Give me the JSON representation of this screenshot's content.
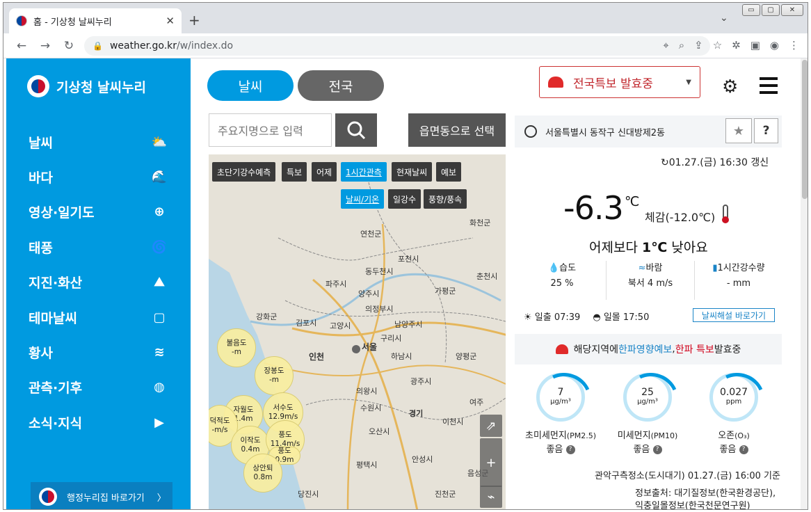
{
  "browser": {
    "tab_title": "홈 - 기상청 날씨누리",
    "tab_close": "✕",
    "new_tab": "+",
    "url_host": "weather.go.kr",
    "url_path": "/w/index.do",
    "win_min": "▭",
    "win_max": "▢",
    "win_close": "✕"
  },
  "sidebar": {
    "logo": "기상청 날씨누리",
    "items": [
      {
        "label": "날씨",
        "icon": "⛅"
      },
      {
        "label": "바다",
        "icon": "🌊"
      },
      {
        "label": "영상·일기도",
        "icon": "⊕"
      },
      {
        "label": "태풍",
        "icon": "🌀"
      },
      {
        "label": "지진·화산",
        "icon": "⛰"
      },
      {
        "label": "테마날씨",
        "icon": "▢"
      },
      {
        "label": "황사",
        "icon": "≋"
      },
      {
        "label": "관측·기후",
        "icon": "◍"
      },
      {
        "label": "소식·지식",
        "icon": "▶"
      }
    ],
    "shortcut": "행정누리집 바로가기",
    "shortcut_arrow": "〉"
  },
  "header": {
    "tab_weather": "날씨",
    "tab_nation": "전국",
    "alert": "전국특보 발효중",
    "alert_caret": "▼"
  },
  "search": {
    "placeholder": "주요지명으로 입력",
    "dong_button": "읍면동으로 선택"
  },
  "map": {
    "tabs": [
      "초단기강수예측",
      "특보",
      "어제",
      "1시간관측",
      "현재날씨",
      "예보"
    ],
    "subtabs": [
      "날씨/기온",
      "일강수",
      "풍향/풍속"
    ],
    "cities": [
      {
        "name": "화천군"
      },
      {
        "name": "연천군"
      },
      {
        "name": "포천시"
      },
      {
        "name": "동두천시"
      },
      {
        "name": "춘천시"
      },
      {
        "name": "파주시"
      },
      {
        "name": "양주시"
      },
      {
        "name": "가평군"
      },
      {
        "name": "의정부시"
      },
      {
        "name": "강화군"
      },
      {
        "name": "김포시"
      },
      {
        "name": "고양시"
      },
      {
        "name": "남양주시"
      },
      {
        "name": "구리시"
      },
      {
        "name": "서울"
      },
      {
        "name": "인천"
      },
      {
        "name": "하남시"
      },
      {
        "name": "양평군"
      },
      {
        "name": "광주시"
      },
      {
        "name": "의왕시"
      },
      {
        "name": "수원시"
      },
      {
        "name": "경기"
      },
      {
        "name": "이천시"
      },
      {
        "name": "여주"
      },
      {
        "name": "오산시"
      },
      {
        "name": "평택시"
      },
      {
        "name": "안성시"
      },
      {
        "name": "음성군"
      },
      {
        "name": "당진시"
      },
      {
        "name": "진천군"
      }
    ],
    "stations": [
      {
        "name": "불음도",
        "value": "-m"
      },
      {
        "name": "장봉도",
        "value": "-m"
      },
      {
        "name": "자월도",
        "value": "1.4m"
      },
      {
        "name": "서수도",
        "value": "12.9m/s"
      },
      {
        "name": "덕적도",
        "value": "-m/s"
      },
      {
        "name": "이작도",
        "value": "0.4m"
      },
      {
        "name": "풍도",
        "value": "11.4m/s"
      },
      {
        "name": "풍도",
        "value": "0.9m"
      },
      {
        "name": "상안퇴",
        "value": "0.8m"
      }
    ]
  },
  "location": {
    "name": "서울특별시 동작구 신대방제2동",
    "star": "★",
    "help": "?"
  },
  "current": {
    "updated": "01.27.(금) 16:30 갱신",
    "temp": "-6.3",
    "unit": "℃",
    "feels": "체감(-12.0℃)",
    "compare_pre": "어제보다 ",
    "compare_val": "1℃",
    "compare_post": " 낮아요",
    "humidity_label": "습도",
    "humidity_value": "25 %",
    "wind_label": "바람",
    "wind_value": "북서 4 m/s",
    "rain_label": "1시간강수량",
    "rain_value": "- mm",
    "sunrise_label": "일출",
    "sunrise": "07:39",
    "sunset_label": "일몰",
    "sunset": "17:50",
    "weather_link": "날씨해설 바로가기"
  },
  "impact": {
    "pre": "해당지역에 ",
    "impact_forecast": "한파영향예보",
    "sep": ",",
    "warning_a": "한파 ",
    "warning_b": "특보",
    "post": " 발효중"
  },
  "air": [
    {
      "value": "7",
      "unit": "μg/m³",
      "name": "초미세먼지",
      "sub": "(PM2.5)",
      "grade": "좋음"
    },
    {
      "value": "25",
      "unit": "μg/m³",
      "name": "미세먼지",
      "sub": "(PM10)",
      "grade": "좋음"
    },
    {
      "value": "0.027",
      "unit": "ppm",
      "name": "오존",
      "sub": "(O₃)",
      "grade": "좋음"
    }
  ],
  "source": {
    "station": "관악구측정소(도시대기) 01.27.(금) 16:00 기준",
    "info": "정보출처: 대기질정보(한국환경공단),",
    "info2": "익충일몰정보(한국천문연구원)"
  }
}
